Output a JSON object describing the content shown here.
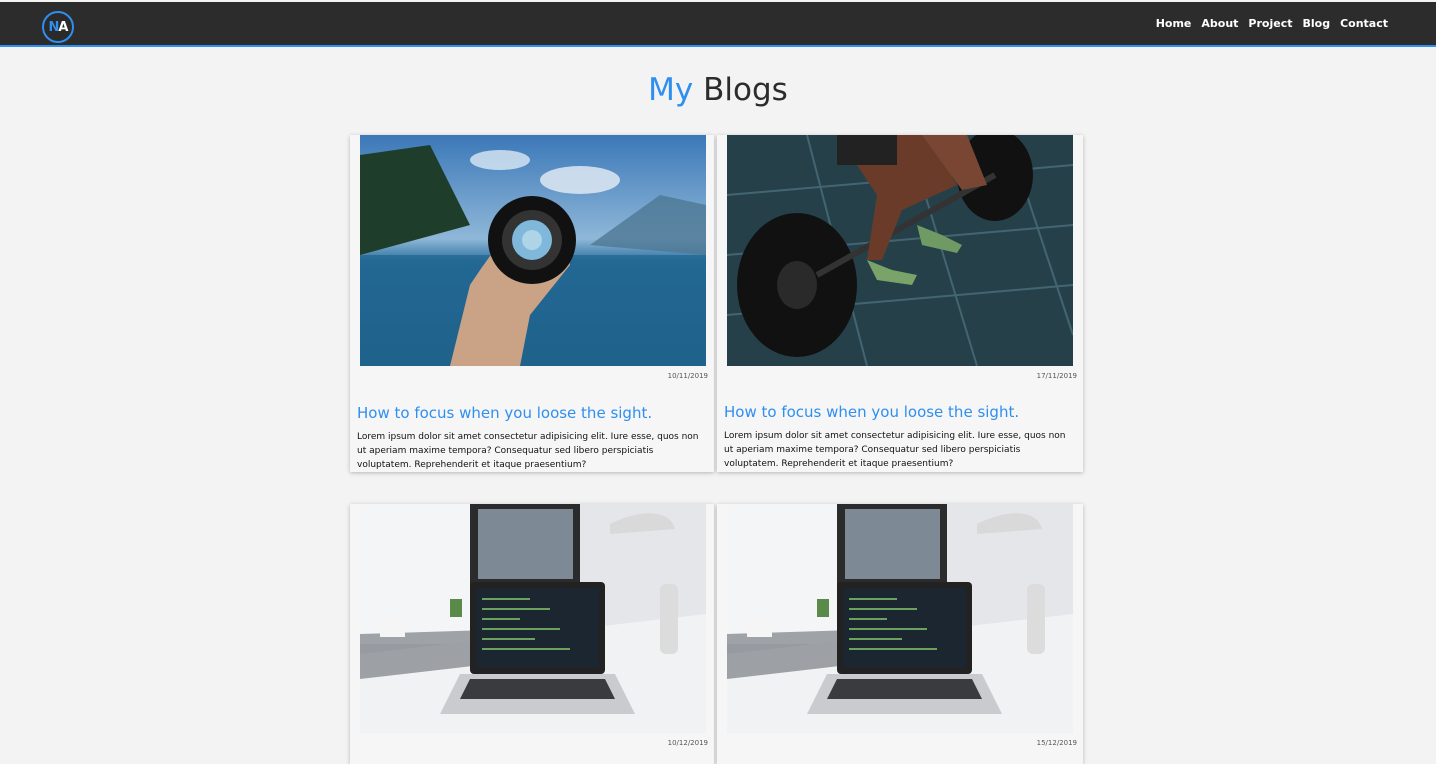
{
  "nav": {
    "logo_n": "N",
    "logo_a": "A",
    "links": [
      "Home",
      "About",
      "Project",
      "Blog",
      "Contact"
    ]
  },
  "page": {
    "title_accent": "My",
    "title_rest": "Blogs"
  },
  "colors": {
    "accent": "#2e8ff0",
    "navbar": "#2c2c2c",
    "background": "#f3f3f3"
  },
  "posts": [
    {
      "date": "10/11/2019",
      "title": "How to focus when you loose the sight.",
      "text": "Lorem ipsum dolor sit amet consectetur adipisicing elit. Iure esse, quos non ut aperiam maxime tempora? Consequatur sed libero perspiciatis voluptatem. Reprehenderit et itaque praesentium?",
      "image": "lens-lake-photo"
    },
    {
      "date": "17/11/2019",
      "title": "How to focus when you loose the sight.",
      "text": "Lorem ipsum dolor sit amet consectetur adipisicing elit. Iure esse, quos non ut aperiam maxime tempora? Consequatur sed libero perspiciatis voluptatem. Reprehenderit et itaque praesentium?",
      "image": "barbell-photo"
    },
    {
      "date": "10/12/2019",
      "image": "laptop-desk-photo"
    },
    {
      "date": "15/12/2019",
      "image": "laptop-desk-photo"
    }
  ]
}
